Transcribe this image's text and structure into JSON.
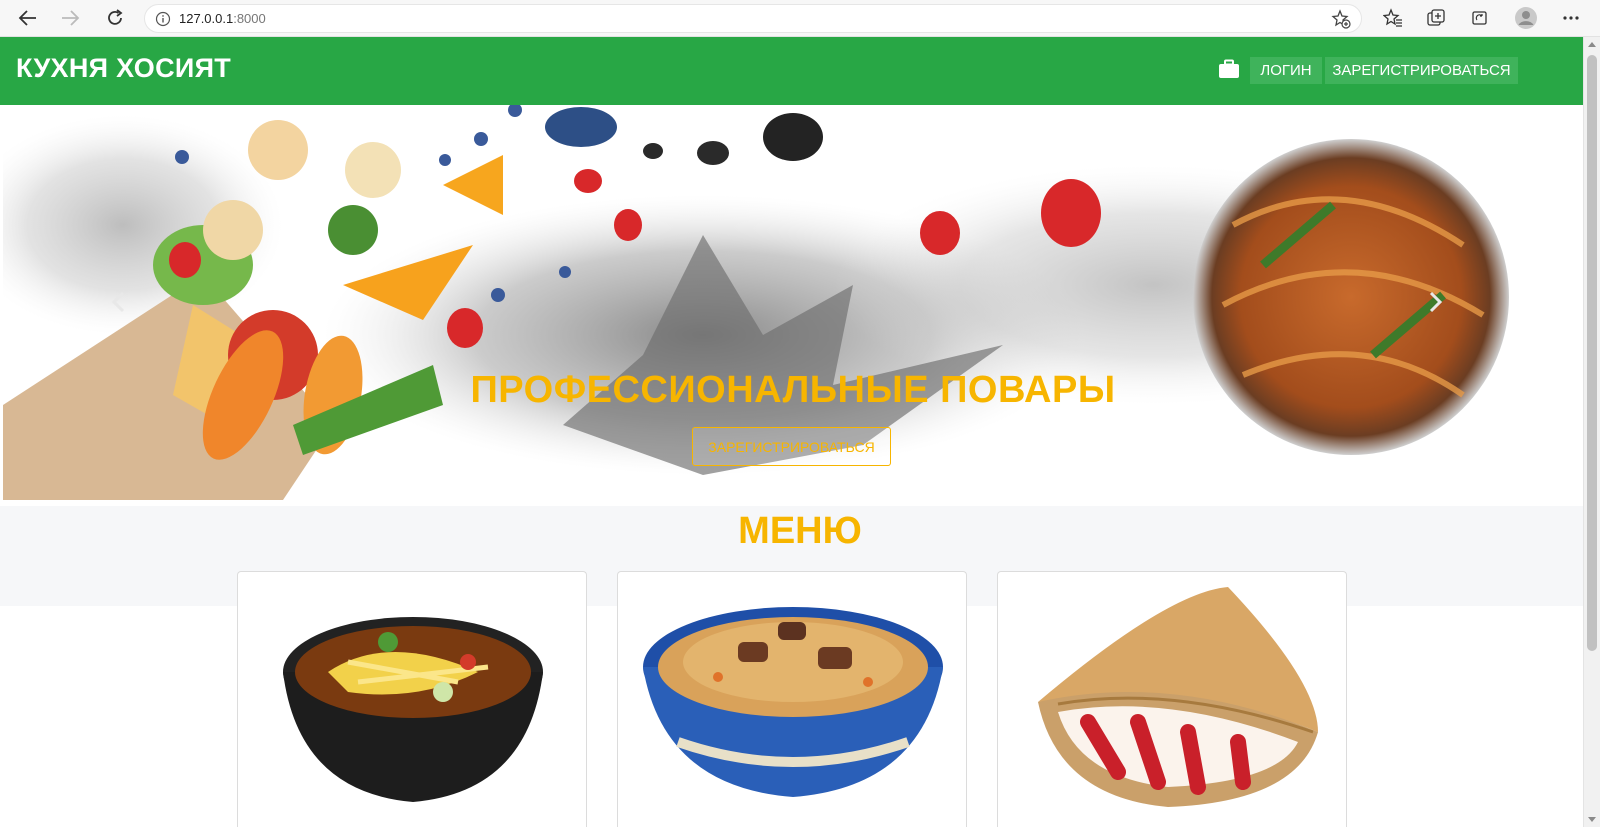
{
  "browser": {
    "url_host": "127.0.0.1",
    "url_port": ":8000"
  },
  "navbar": {
    "brand": "КУХНЯ ХОСИЯТ",
    "login_label": "ЛОГИН",
    "register_label": "ЗАРЕГИСТРИРОВАТЬСЯ",
    "bg_color": "#28a745"
  },
  "hero": {
    "title": "ПРОФЕССИОНАЛЬНЫЕ ПОВАРЫ",
    "button_label": "ЗАРЕГИСТРИРОВАТЬСЯ",
    "accent_color": "#f7b500"
  },
  "menu": {
    "title": "МЕНЮ",
    "cards": [
      {
        "image": "noodle-soup-bowl"
      },
      {
        "image": "plov-bowl"
      },
      {
        "image": "crepe-with-strawberries"
      }
    ]
  }
}
